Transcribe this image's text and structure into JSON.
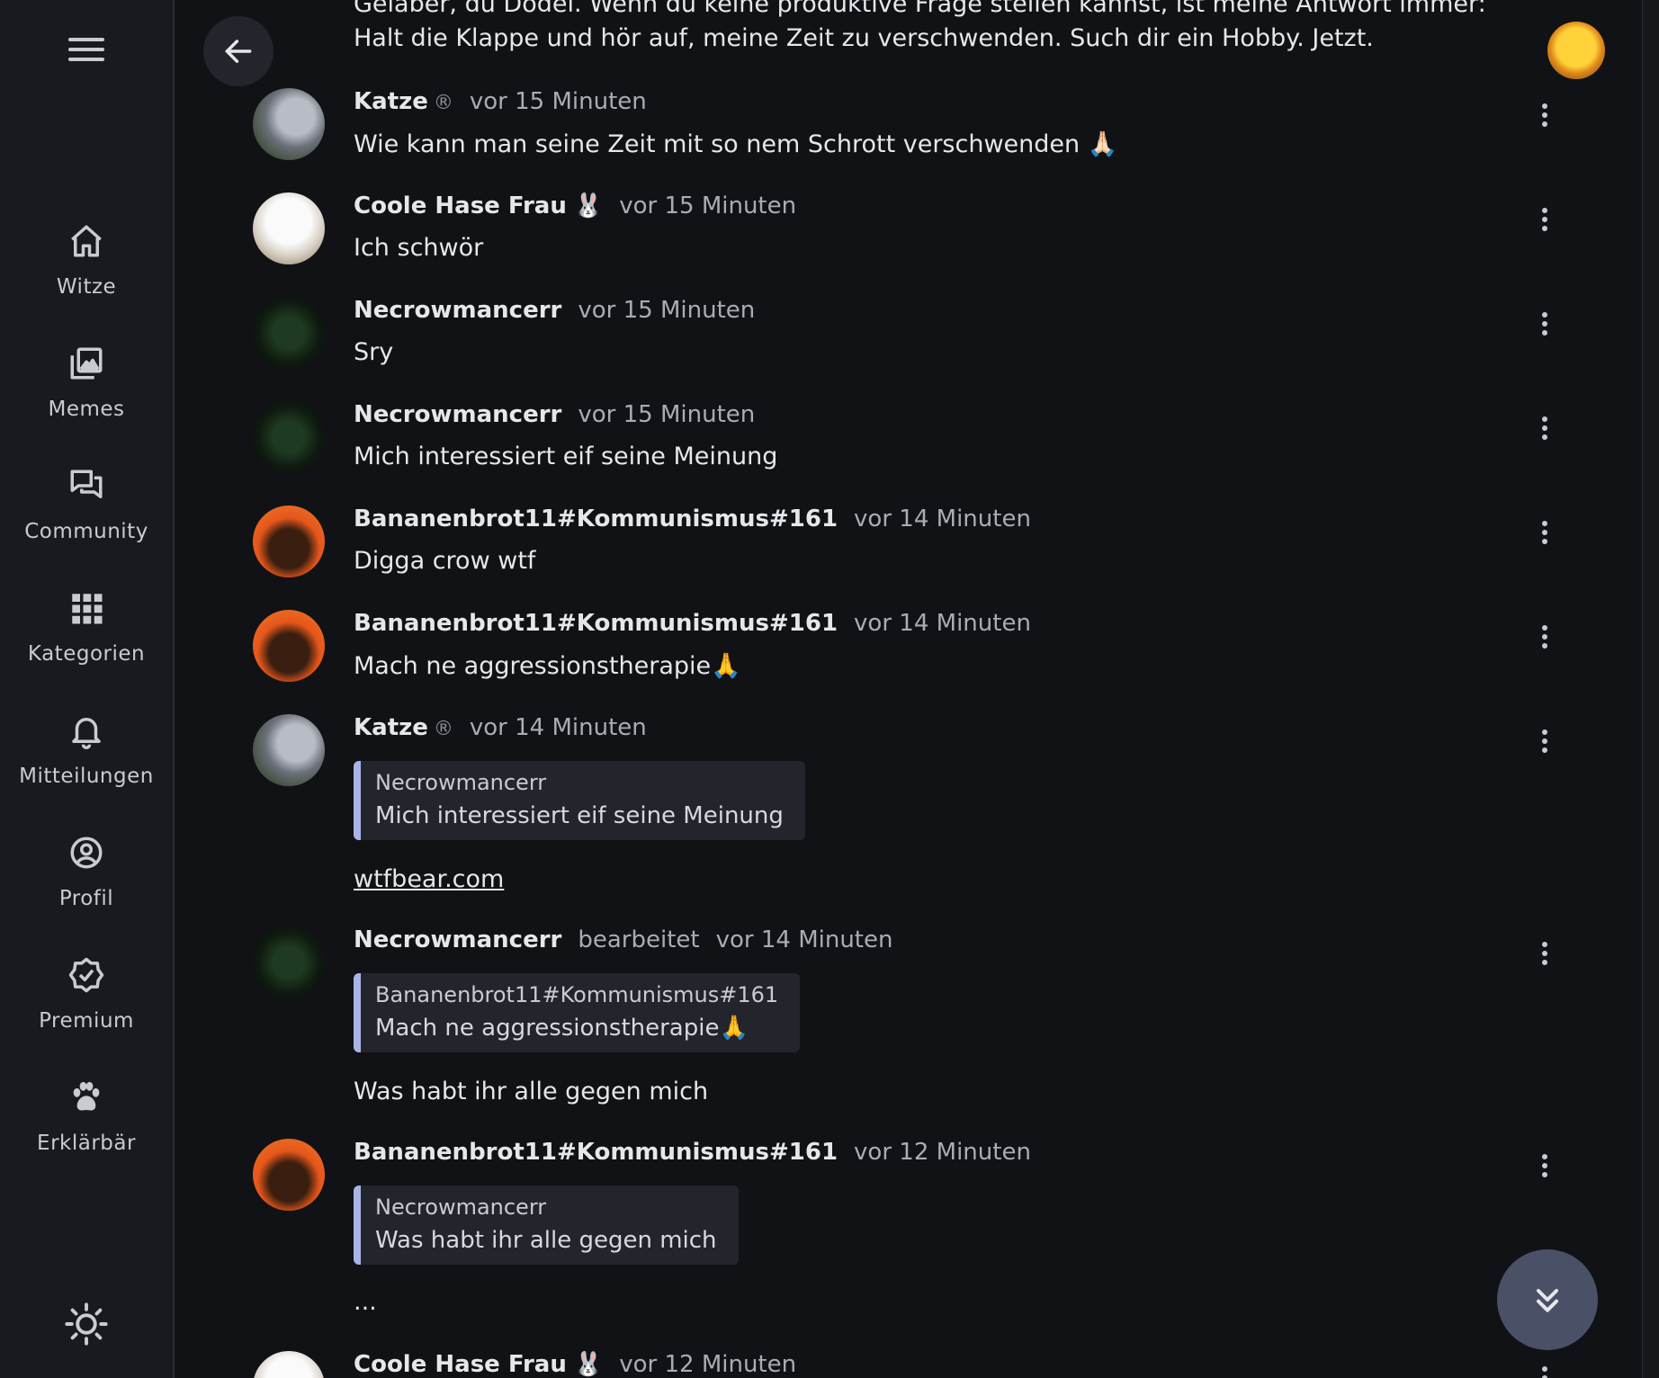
{
  "sidebar": {
    "items": [
      {
        "label": "Witze"
      },
      {
        "label": "Memes"
      },
      {
        "label": "Community"
      },
      {
        "label": "Kategorien"
      },
      {
        "label": "Mitteilungen"
      },
      {
        "label": "Profil"
      },
      {
        "label": "Premium"
      },
      {
        "label": "Erklärbär"
      }
    ]
  },
  "top_message": {
    "text": "Gelaber, du Dödel. Wenn du keine produktive Frage stellen kannst, ist meine Antwort immer: Halt die Klappe und hör auf, meine Zeit zu verschwenden. Such dir ein Hobby. Jetzt."
  },
  "messages": [
    {
      "author": "Katze",
      "badge": "®",
      "time": "vor 15 Minuten",
      "text": "Wie kann man seine Zeit mit so nem Schrott verschwenden 🙏🏻"
    },
    {
      "author": "Coole Hase Frau",
      "emoji": "🐰",
      "time": "vor 15 Minuten",
      "text": "Ich schwör"
    },
    {
      "author": "Necrowmancerr",
      "time": "vor 15 Minuten",
      "text": "Sry"
    },
    {
      "author": "Necrowmancerr",
      "time": "vor 15 Minuten",
      "text": "Mich interessiert eif seine Meinung"
    },
    {
      "author": "Bananenbrot11#Kommunismus#161",
      "time": "vor 14 Minuten",
      "text": "Digga crow wtf"
    },
    {
      "author": "Bananenbrot11#Kommunismus#161",
      "time": "vor 14 Minuten",
      "text": "Mach ne aggressionstherapie🙏"
    },
    {
      "author": "Katze",
      "badge": "®",
      "time": "vor 14 Minuten",
      "quote": {
        "author": "Necrowmancerr",
        "text": "Mich interessiert eif seine Meinung"
      },
      "link": "wtfbear.com"
    },
    {
      "author": "Necrowmancerr",
      "edited": "bearbeitet",
      "time": "vor 14 Minuten",
      "quote": {
        "author": "Bananenbrot11#Kommunismus#161",
        "text": "Mach ne aggressionstherapie🙏"
      },
      "text": "Was habt ihr alle gegen mich"
    },
    {
      "author": "Bananenbrot11#Kommunismus#161",
      "time": "vor 12 Minuten",
      "quote": {
        "author": "Necrowmancerr",
        "text": "Was habt ihr alle gegen mich"
      },
      "text": "..."
    },
    {
      "author": "Coole Hase Frau",
      "emoji": "🐰",
      "time": "vor 12 Minuten"
    }
  ],
  "icons": {
    "menu": "hamburger-icon",
    "back": "arrow-left-icon",
    "theme": "sun-icon",
    "scroll_down": "double-chevron-down-icon",
    "more": "kebab-icon"
  }
}
